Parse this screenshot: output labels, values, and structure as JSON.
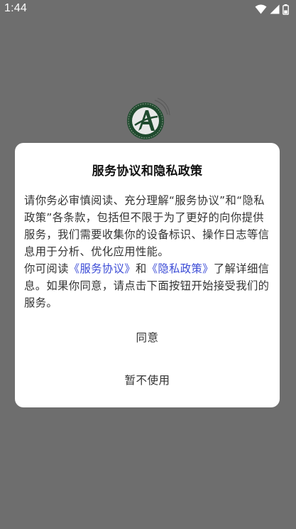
{
  "status_bar": {
    "time": "1:44",
    "icons": [
      "wifi-icon",
      "cellular-signal-icon",
      "battery-icon"
    ]
  },
  "dialog": {
    "title": "服务协议和隐私政策",
    "paragraph1": "请你务必审慎阅读、充分理解“服务协议”和“隐私政策”各条款，包括但不限于为了更好的向你提供服务，我们需要收集你的设备标识、操作日志等信息用于分析、优化应用性能。",
    "paragraph2": {
      "prefix": "你可阅读",
      "link_service": "《服务协议》",
      "and": "和",
      "link_privacy": "《隐私政策》",
      "suffix": "了解详细信息。如果你同意，请点击下面按钮开始接受我们的服务。"
    },
    "agree_button": "同意",
    "decline_button": "暂不使用"
  },
  "colors": {
    "overlay_background": "#6e6e6e",
    "dialog_background": "#ffffff",
    "link": "#3b4bd6",
    "logo_green": "#1f4a2e"
  }
}
